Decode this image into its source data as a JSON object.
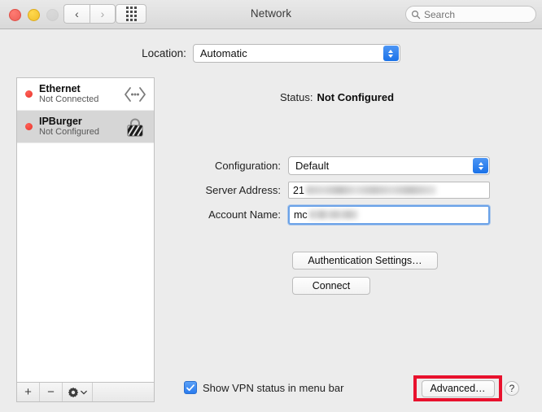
{
  "window": {
    "title": "Network",
    "traffic_lights": [
      "close",
      "minimize",
      "zoom"
    ]
  },
  "toolbar": {
    "back_glyph": "‹",
    "forward_glyph": "›",
    "show_all_icon": "grid-icon",
    "search": {
      "placeholder": "Search",
      "value": "",
      "icon": "search-icon"
    }
  },
  "location": {
    "label": "Location:",
    "value": "Automatic"
  },
  "sidebar": {
    "services": [
      {
        "name": "Ethernet",
        "status": "Not Connected",
        "icon": "ethernet-icon",
        "selected": false,
        "dot_color": "#e8352b"
      },
      {
        "name": "IPBurger",
        "status": "Not Configured",
        "icon": "vpn-lock-icon",
        "selected": true,
        "dot_color": "#e8352b"
      }
    ],
    "toolbar": {
      "add": "+",
      "remove": "−",
      "action": "gear-icon"
    }
  },
  "main": {
    "status": {
      "label": "Status:",
      "value": "Not Configured"
    },
    "fields": [
      {
        "label": "Configuration:",
        "value": "Default",
        "type": "popup",
        "focused": false,
        "redacted": false
      },
      {
        "label": "Server Address:",
        "value": "21",
        "type": "text",
        "focused": false,
        "redacted": true,
        "redacted_width": 160
      },
      {
        "label": "Account Name:",
        "value": "mc",
        "type": "text",
        "focused": true,
        "redacted": true,
        "redacted_width": 60
      }
    ],
    "buttons": {
      "authentication": "Authentication Settings…",
      "connect": "Connect"
    }
  },
  "footer": {
    "show_status_checkbox": {
      "label": "Show VPN status in menu bar",
      "checked": true
    },
    "advanced_button": "Advanced…",
    "help_button": "?"
  },
  "annotation": {
    "highlight_color": "#e8112d",
    "target": "advanced-button"
  }
}
